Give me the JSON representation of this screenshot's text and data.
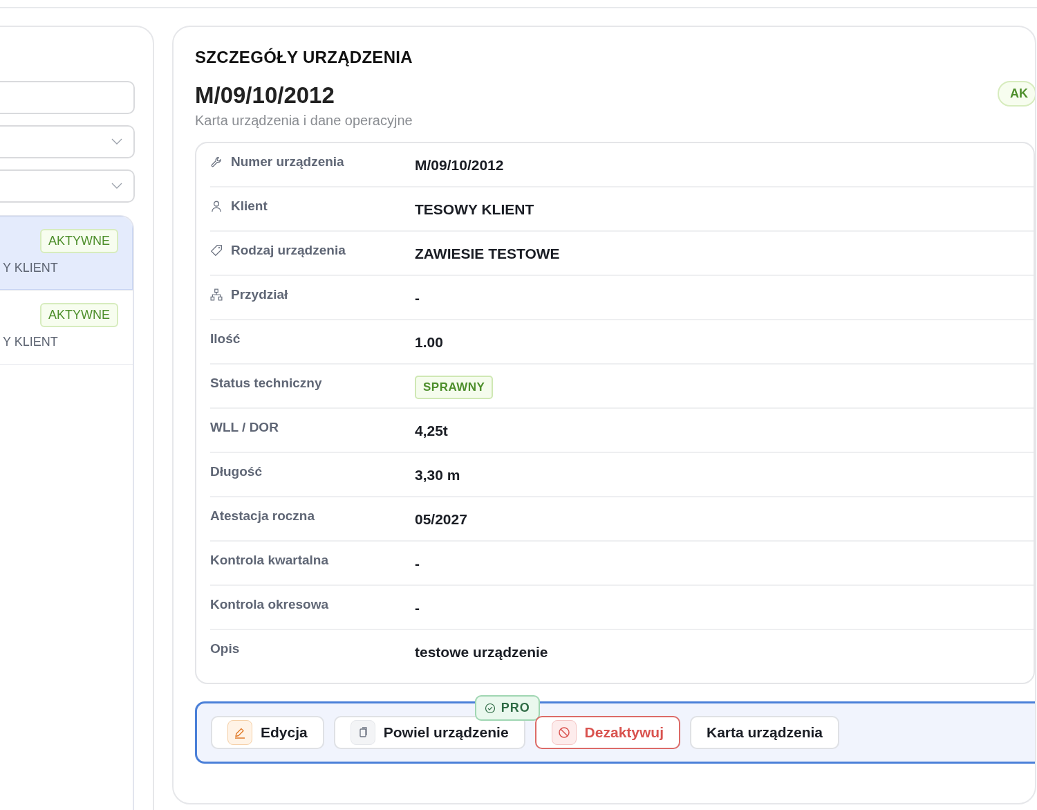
{
  "sidebar": {
    "filters": [
      {
        "kind": "input"
      },
      {
        "kind": "select"
      },
      {
        "kind": "select"
      }
    ],
    "items": [
      {
        "badge": "AKTYWNE",
        "client": "Y KLIENT",
        "selected": true
      },
      {
        "badge": "AKTYWNE",
        "client": "Y KLIENT",
        "selected": false
      }
    ]
  },
  "details": {
    "heading": "SZCZEGÓŁY URZĄDZENIA",
    "title": "M/09/10/2012",
    "subtitle": "Karta urządzenia i dane operacyjne",
    "status": "AK",
    "rows": [
      {
        "label": "Numer urządzenia",
        "value": "M/09/10/2012",
        "kind": "text"
      },
      {
        "label": "Klient",
        "value": "TESOWY KLIENT",
        "kind": "text"
      },
      {
        "label": "Rodzaj urządzenia",
        "value": "ZAWIESIE TESTOWE",
        "kind": "text"
      },
      {
        "label": "Przydział",
        "value": "-",
        "kind": "text"
      },
      {
        "label": "Ilość",
        "value": "1.00",
        "kind": "text"
      },
      {
        "label": "Status techniczny",
        "value": "SPRAWNY",
        "kind": "badge"
      },
      {
        "label": "WLL / DOR",
        "value": "4,25t",
        "kind": "text"
      },
      {
        "label": "Długość",
        "value": "3,30 m",
        "kind": "text"
      },
      {
        "label": "Atestacja roczna",
        "value": "05/2027",
        "kind": "text"
      },
      {
        "label": "Kontrola kwartalna",
        "value": "-",
        "kind": "text"
      },
      {
        "label": "Kontrola okresowa",
        "value": "-",
        "kind": "text"
      },
      {
        "label": "Opis",
        "value": "testowe urządzenie",
        "kind": "text"
      }
    ],
    "actions": [
      {
        "label": "Edycja",
        "kind": "edit"
      },
      {
        "label": "Powiel urządzenie",
        "kind": "duplicate",
        "badge": "PRO"
      },
      {
        "label": "Dezaktywuj",
        "kind": "danger"
      },
      {
        "label": "Karta urządzenia",
        "kind": "plain"
      }
    ]
  }
}
